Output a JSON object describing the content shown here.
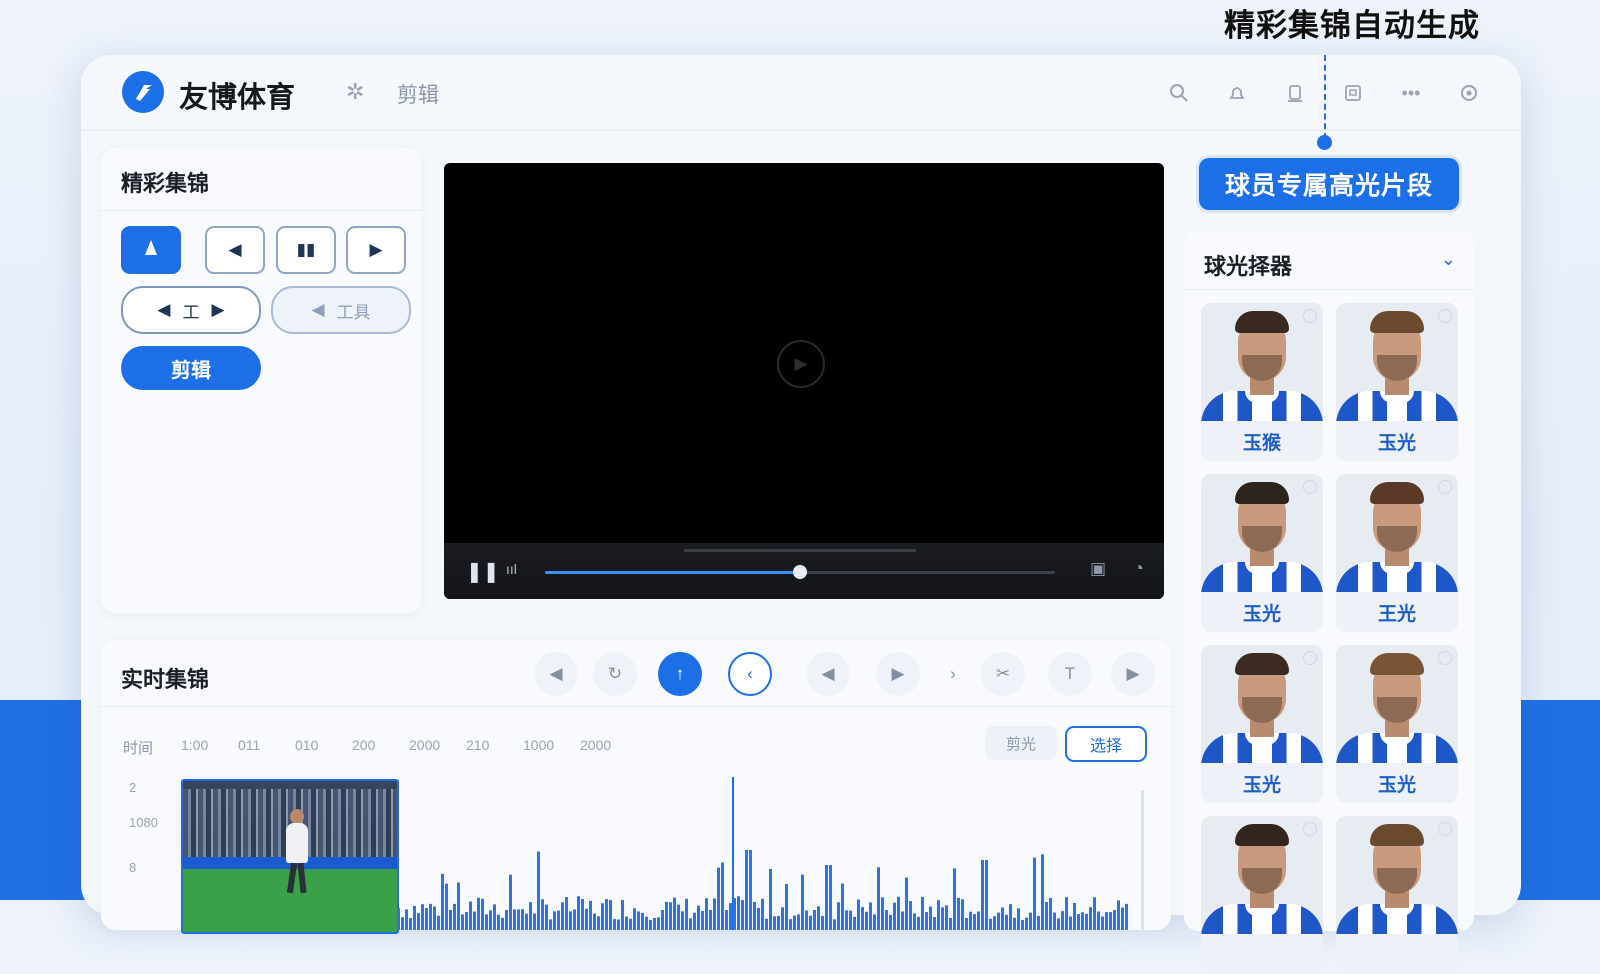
{
  "caption": "精彩集锦自动生成",
  "header": {
    "logo_glyph": "",
    "brand": "友博体育",
    "edit_label": "剪辑",
    "icons": [
      "search-icon",
      "bell-icon",
      "device-icon",
      "window-icon",
      "more-icon",
      "settings-icon"
    ]
  },
  "highlights_panel": {
    "title": "精彩集锦",
    "tool_row": [
      "cone-icon",
      "prev-icon",
      "pause-icon",
      "next-icon"
    ],
    "tool_pill_label": "工",
    "tool_pill2_label": "工具",
    "cut_label": "剪辑"
  },
  "video": {
    "progress": 0.5
  },
  "realtime_panel": {
    "title": "实时集锦",
    "time_label": "时间",
    "ticks": [
      "1:00",
      "011",
      "010",
      "200",
      "2000",
      "210",
      "1000",
      "2000"
    ],
    "y_labels": [
      "2",
      "1080",
      "8"
    ],
    "clip_button": "剪光",
    "select_button": "选择"
  },
  "player_highlight_button": "球员专属高光片段",
  "player_picker": {
    "title": "球光择器",
    "players": [
      {
        "name": "玉猴"
      },
      {
        "name": "玉光"
      },
      {
        "name": "玉光"
      },
      {
        "name": "王光"
      },
      {
        "name": "玉光"
      },
      {
        "name": "玉光"
      },
      {
        "name": ""
      },
      {
        "name": ""
      }
    ]
  },
  "colors": {
    "accent": "#1d6fe8",
    "background": "#eef3fb",
    "video_bg": "#000000"
  }
}
